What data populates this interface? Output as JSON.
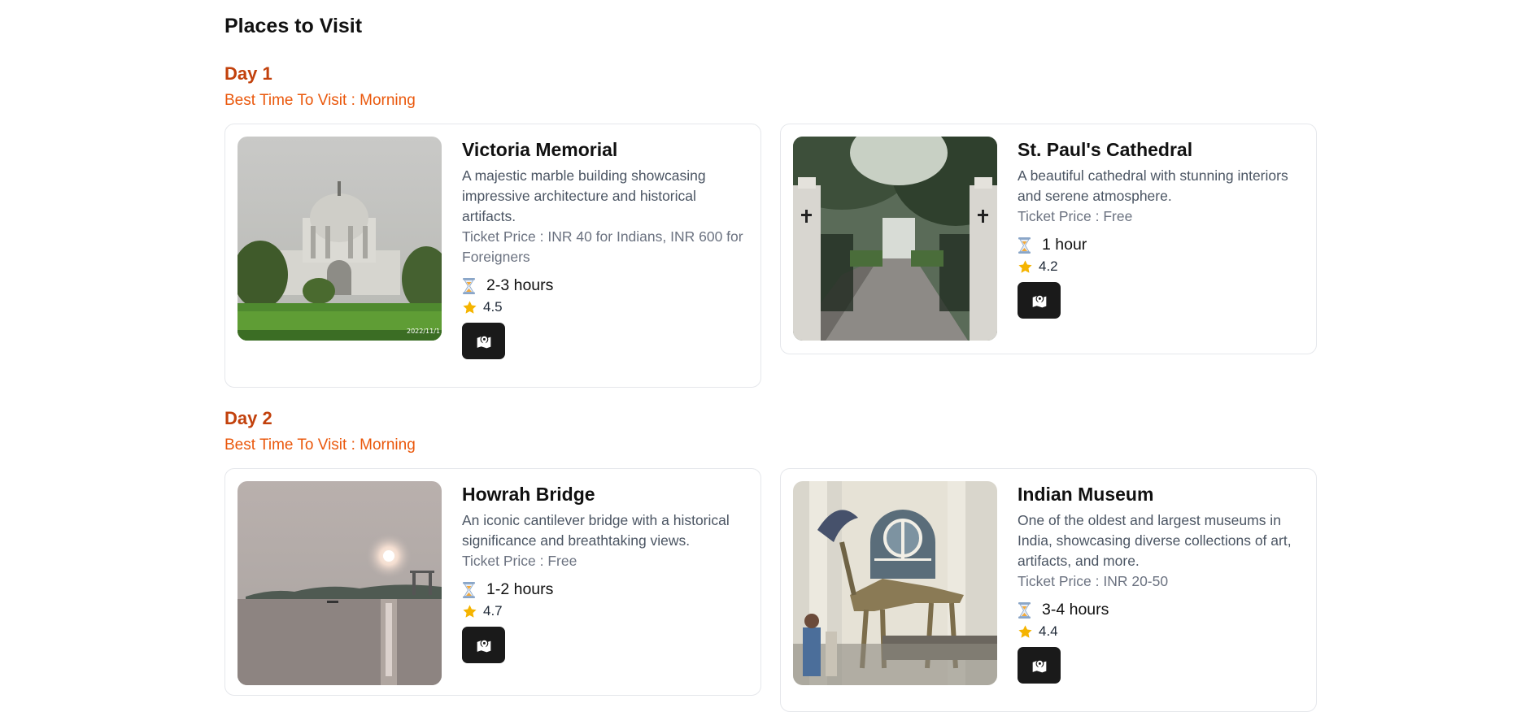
{
  "page": {
    "title": "Places to Visit"
  },
  "days": [
    {
      "title": "Day 1",
      "best_time": "Best Time To Visit : Morning",
      "places": [
        {
          "name": "Victoria Memorial",
          "description": "A majestic marble building showcasing impressive architecture and historical artifacts.",
          "ticket": "Ticket Price : INR 40 for Indians, INR 600 for Foreigners",
          "duration": "2-3 hours",
          "rating": "4.5",
          "image_stamp": "2022/11/1",
          "icons": {
            "duration": "hourglass-icon",
            "rating": "star-icon",
            "map": "map-pin-icon"
          }
        },
        {
          "name": "St. Paul's Cathedral",
          "description": "A beautiful cathedral with stunning interiors and serene atmosphere.",
          "ticket": "Ticket Price : Free",
          "duration": "1 hour",
          "rating": "4.2",
          "icons": {
            "duration": "hourglass-icon",
            "rating": "star-icon",
            "map": "map-pin-icon"
          }
        }
      ]
    },
    {
      "title": "Day 2",
      "best_time": "Best Time To Visit : Morning",
      "places": [
        {
          "name": "Howrah Bridge",
          "description": "An iconic cantilever bridge with a historical significance and breathtaking views.",
          "ticket": "Ticket Price : Free",
          "duration": "1-2 hours",
          "rating": "4.7",
          "icons": {
            "duration": "hourglass-icon",
            "rating": "star-icon",
            "map": "map-pin-icon"
          }
        },
        {
          "name": "Indian Museum",
          "description": "One of the oldest and largest museums in India, showcasing diverse collections of art, artifacts, and more.",
          "ticket": "Ticket Price : INR 20-50",
          "duration": "3-4 hours",
          "rating": "4.4",
          "icons": {
            "duration": "hourglass-icon",
            "rating": "star-icon",
            "map": "map-pin-icon"
          }
        }
      ]
    }
  ],
  "colors": {
    "day_title": "#c2410c",
    "best_time": "#ea580c",
    "map_button": "#1a1a1a",
    "star": "#f5b400",
    "card_border": "#e5e7eb"
  }
}
